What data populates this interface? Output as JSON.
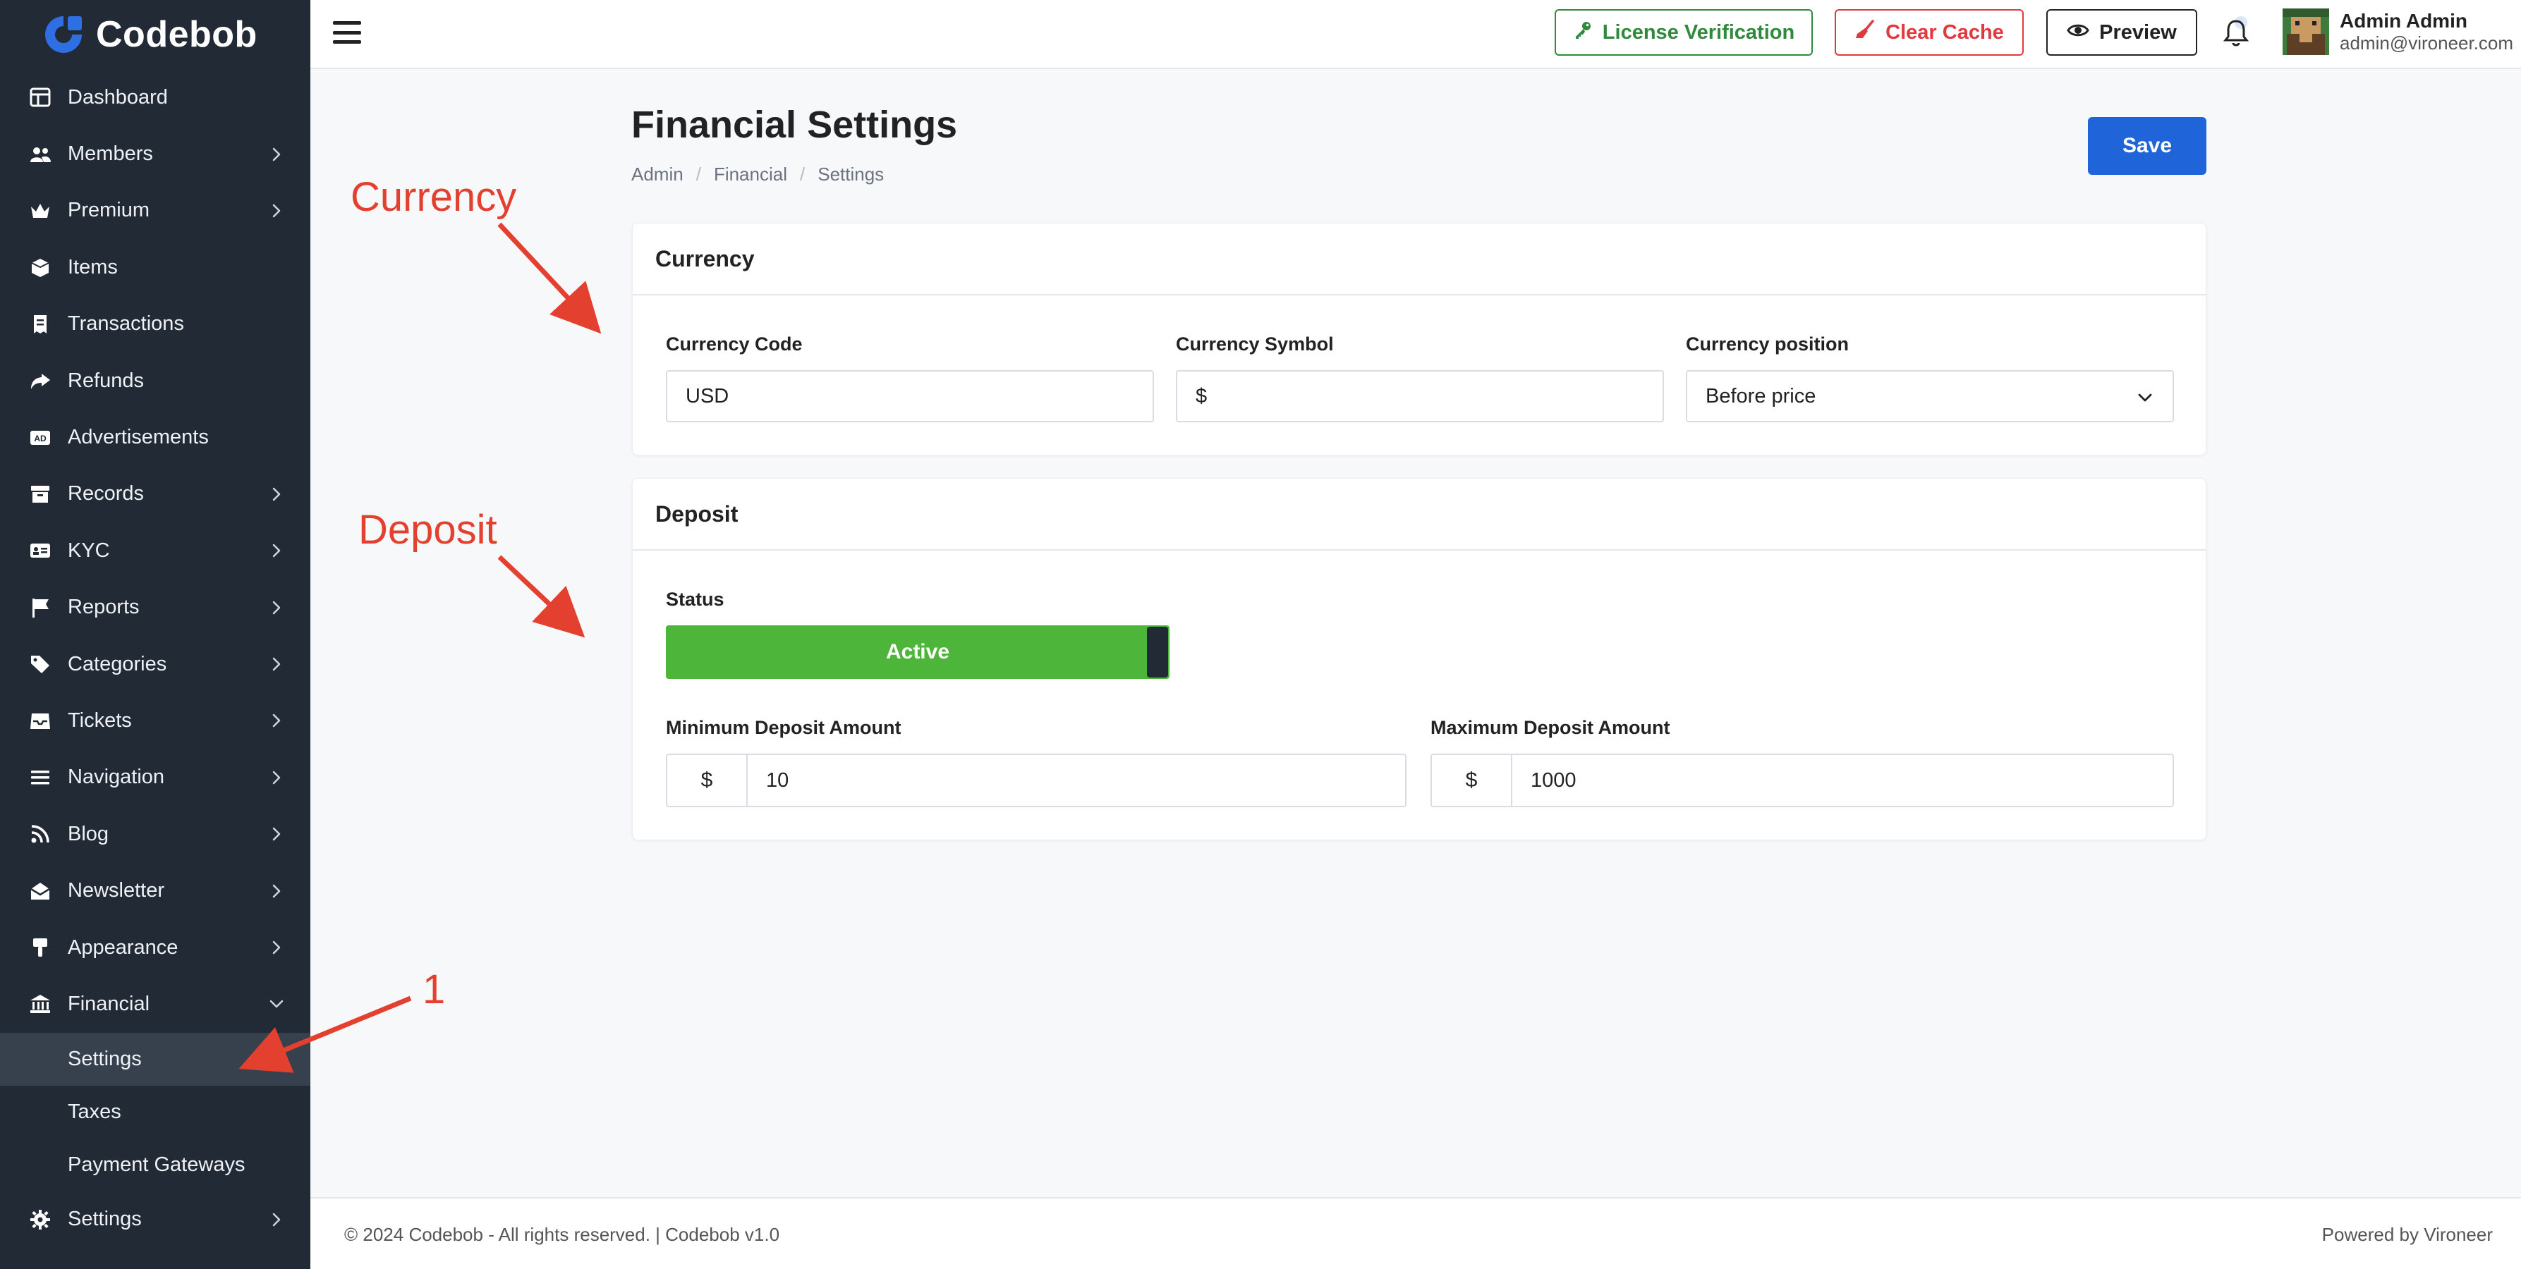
{
  "brand": {
    "name": "Codebob"
  },
  "sidebar": {
    "items": [
      {
        "label": "Dashboard",
        "icon": "dashboard-icon",
        "chevron": false
      },
      {
        "label": "Members",
        "icon": "users-icon",
        "chevron": true
      },
      {
        "label": "Premium",
        "icon": "crown-icon",
        "chevron": true
      },
      {
        "label": "Items",
        "icon": "box-icon",
        "chevron": false
      },
      {
        "label": "Transactions",
        "icon": "receipt-icon",
        "chevron": false
      },
      {
        "label": "Refunds",
        "icon": "share-icon",
        "chevron": false
      },
      {
        "label": "Advertisements",
        "icon": "ad-icon",
        "chevron": false
      },
      {
        "label": "Records",
        "icon": "archive-icon",
        "chevron": true
      },
      {
        "label": "KYC",
        "icon": "id-card-icon",
        "chevron": true
      },
      {
        "label": "Reports",
        "icon": "flag-icon",
        "chevron": true
      },
      {
        "label": "Categories",
        "icon": "tags-icon",
        "chevron": true
      },
      {
        "label": "Tickets",
        "icon": "inbox-icon",
        "chevron": true
      },
      {
        "label": "Navigation",
        "icon": "bars-icon",
        "chevron": true
      },
      {
        "label": "Blog",
        "icon": "rss-icon",
        "chevron": true
      },
      {
        "label": "Newsletter",
        "icon": "envelope-open-icon",
        "chevron": true
      },
      {
        "label": "Appearance",
        "icon": "brush-icon",
        "chevron": true
      },
      {
        "label": "Financial",
        "icon": "bank-icon",
        "chevron": true
      }
    ],
    "financial_sub": [
      "Settings",
      "Taxes",
      "Payment Gateways"
    ],
    "bottom_item": {
      "label": "Settings",
      "icon": "gear-icon"
    }
  },
  "topbar": {
    "license_label": "License Verification",
    "cache_label": "Clear Cache",
    "preview_label": "Preview",
    "user_name": "Admin Admin",
    "user_email": "admin@vironeer.com"
  },
  "page": {
    "title": "Financial Settings",
    "breadcrumb": [
      "Admin",
      "Financial",
      "Settings"
    ],
    "save_label": "Save"
  },
  "currency": {
    "heading": "Currency",
    "code_label": "Currency Code",
    "code_value": "USD",
    "symbol_label": "Currency Symbol",
    "symbol_value": "$",
    "position_label": "Currency position",
    "position_value": "Before price"
  },
  "deposit": {
    "heading": "Deposit",
    "status_label": "Status",
    "status_value": "Active",
    "min_label": "Minimum Deposit Amount",
    "min_addon": "$",
    "min_value": "10",
    "max_label": "Maximum Deposit Amount",
    "max_addon": "$",
    "max_value": "1000"
  },
  "annotations": {
    "currency": "Currency",
    "deposit": "Deposit",
    "one": "1"
  },
  "footer": {
    "left": "© 2024 Codebob - All rights reserved. | Codebob v1.0",
    "right": "Powered by Vironeer"
  },
  "colors": {
    "sidebar_bg": "#222a35",
    "primary": "#1f64d8",
    "success": "#4cb53a",
    "danger": "#e0393e",
    "annotation": "#e3402f"
  }
}
